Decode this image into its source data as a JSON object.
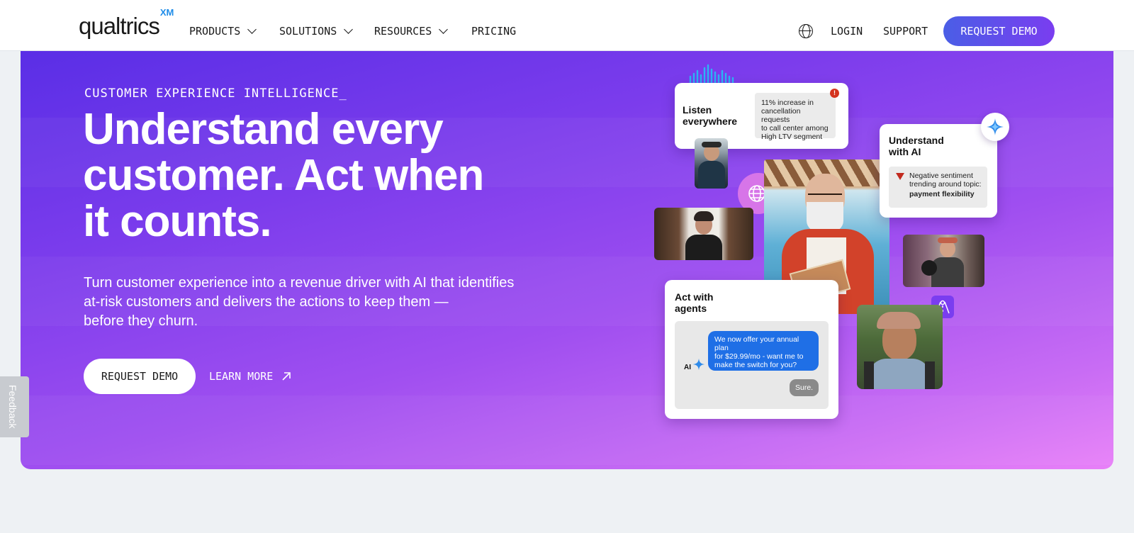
{
  "nav": {
    "logo": "qualtrics",
    "logo_badge": "XM",
    "items": [
      {
        "label": "PRODUCTS",
        "has_dropdown": true
      },
      {
        "label": "SOLUTIONS",
        "has_dropdown": true
      },
      {
        "label": "RESOURCES",
        "has_dropdown": true
      },
      {
        "label": "PRICING",
        "has_dropdown": false
      }
    ],
    "language_icon": "globe-icon",
    "login": "LOGIN",
    "support": "SUPPORT",
    "cta": "REQUEST DEMO"
  },
  "hero": {
    "eyebrow": "CUSTOMER EXPERIENCE INTELLIGENCE_",
    "headline_lines": [
      "Understand every",
      "customer. Act when",
      "it counts."
    ],
    "subtext_lines": [
      "Turn customer experience into a revenue driver with AI that identifies",
      "at-risk customers and delivers the actions to keep them —",
      "before they churn."
    ],
    "primary_cta": "REQUEST DEMO",
    "secondary_cta": "LEARN MORE",
    "colors": {
      "gradient_start": "#5a2ee6",
      "gradient_end": "#e880f8"
    }
  },
  "collage": {
    "listen": {
      "title_lines": [
        "Listen",
        "everywhere"
      ],
      "alert_lines": [
        "11% increase in",
        "cancellation requests",
        "to call center among",
        "High LTV segment"
      ]
    },
    "understand": {
      "title_lines": [
        "Understand",
        "with AI"
      ],
      "insight_lines": [
        "Negative sentiment",
        "trending around topic:"
      ],
      "insight_topic": "payment flexibility"
    },
    "act": {
      "title_lines": [
        "Act with",
        "agents"
      ],
      "ai_label": "AI",
      "ai_message_lines": [
        "We now offer your annual plan",
        "for $29.99/mo - want me to",
        "make the switch for you?"
      ],
      "reply": "Sure."
    }
  },
  "feedback": "Feedback"
}
